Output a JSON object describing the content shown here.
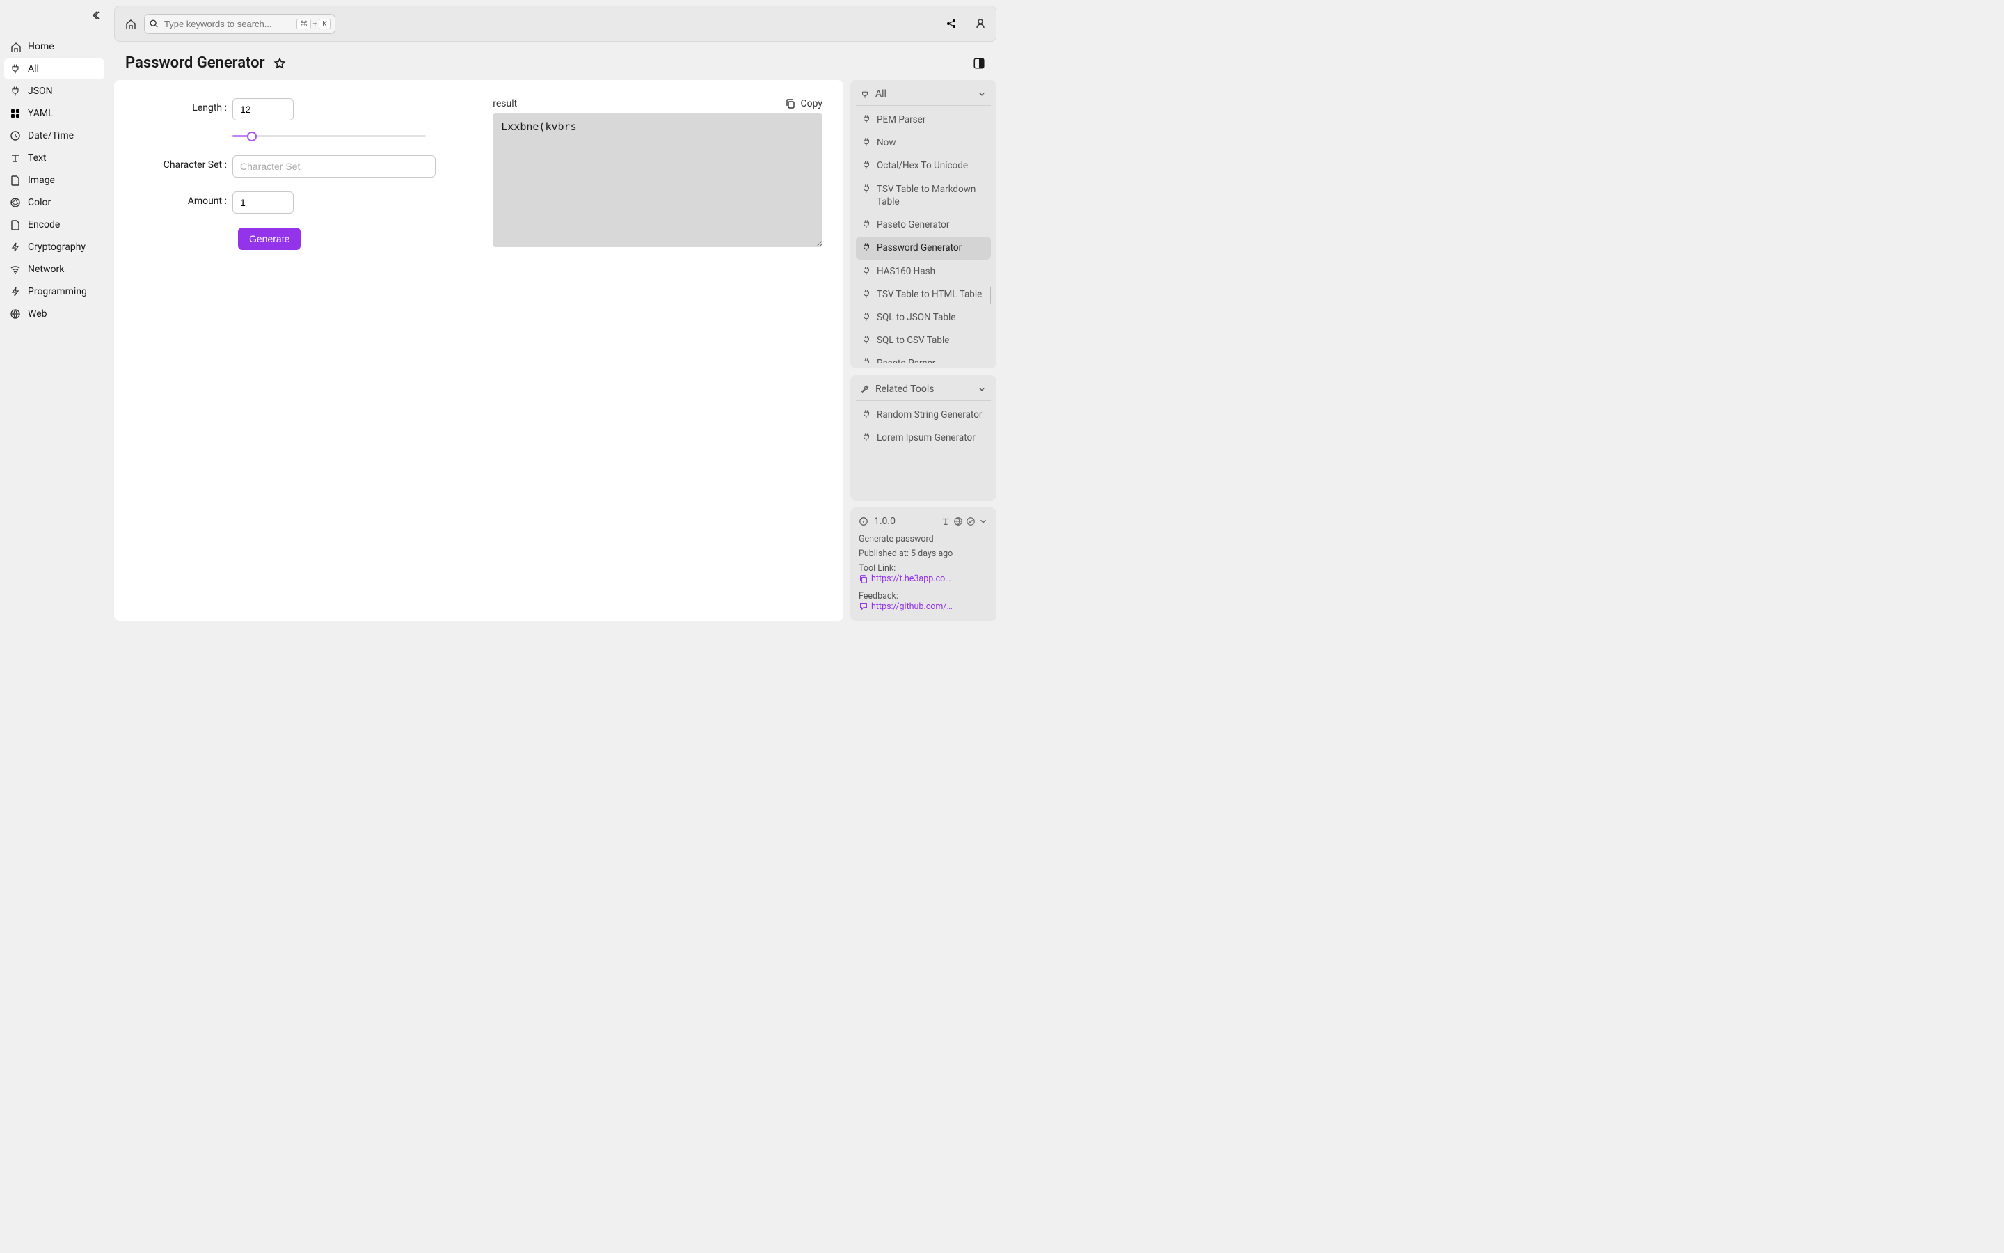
{
  "search": {
    "placeholder": "Type keywords to search...",
    "kbd1": "⌘",
    "kbdplus": "+",
    "kbd2": "K"
  },
  "page": {
    "title": "Password Generator"
  },
  "sidebar": {
    "items": [
      {
        "label": "Home",
        "icon": "home"
      },
      {
        "label": "All",
        "icon": "plug",
        "active": true
      },
      {
        "label": "JSON",
        "icon": "plug"
      },
      {
        "label": "YAML",
        "icon": "grid"
      },
      {
        "label": "Date/Time",
        "icon": "clock"
      },
      {
        "label": "Text",
        "icon": "text"
      },
      {
        "label": "Image",
        "icon": "file"
      },
      {
        "label": "Color",
        "icon": "aperture"
      },
      {
        "label": "Encode",
        "icon": "file"
      },
      {
        "label": "Cryptography",
        "icon": "bolt"
      },
      {
        "label": "Network",
        "icon": "wifi"
      },
      {
        "label": "Programming",
        "icon": "bolt"
      },
      {
        "label": "Web",
        "icon": "globe"
      }
    ]
  },
  "form": {
    "length_label": "Length",
    "length_value": "12",
    "charset_label": "Character Set",
    "charset_placeholder": "Character Set",
    "amount_label": "Amount",
    "amount_value": "1",
    "generate_label": "Generate"
  },
  "result": {
    "label": "result",
    "copy_label": "Copy",
    "value": "Lxxbne(kvbrs"
  },
  "right": {
    "all_title": "All",
    "all_items": [
      {
        "label": "PEM Parser"
      },
      {
        "label": "Now"
      },
      {
        "label": "Octal/Hex To Unicode"
      },
      {
        "label": "TSV Table to Markdown Table"
      },
      {
        "label": "Paseto Generator"
      },
      {
        "label": "Password Generator",
        "active": true
      },
      {
        "label": "HAS160 Hash"
      },
      {
        "label": "TSV Table to HTML Table"
      },
      {
        "label": "SQL to JSON Table"
      },
      {
        "label": "SQL to CSV Table"
      },
      {
        "label": "Paseto Parser"
      }
    ],
    "related_title": "Related Tools",
    "related_items": [
      {
        "label": "Random String Generator"
      },
      {
        "label": "Lorem Ipsum Generator"
      }
    ],
    "info": {
      "version": "1.0.0",
      "desc": "Generate password",
      "published_label": "Published at:",
      "published_value": "5 days ago",
      "tool_link_label": "Tool Link:",
      "tool_link_value": "https://t.he3app.co…",
      "feedback_label": "Feedback:",
      "feedback_value": "https://github.com/…"
    }
  }
}
